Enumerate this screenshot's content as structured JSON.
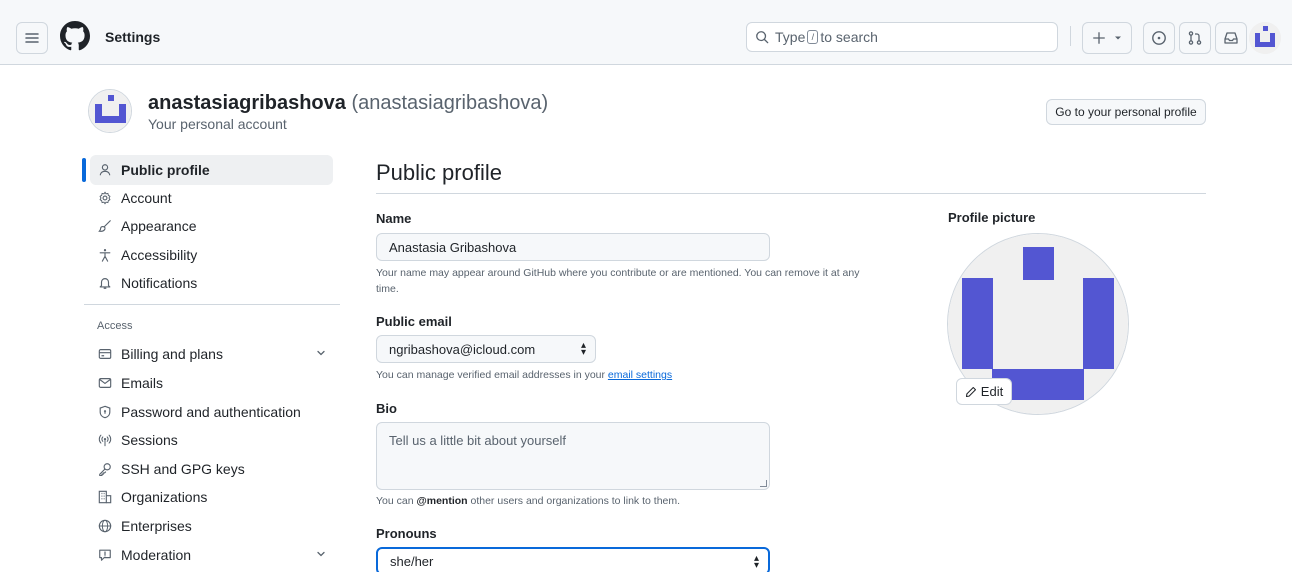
{
  "header": {
    "context_title": "Settings",
    "search": {
      "prefix": "Type",
      "key": "/",
      "suffix": "to search"
    }
  },
  "account": {
    "display_name": "anastasiagribashova",
    "login_paren": "(anastasiagribashova)",
    "subtitle": "Your personal account",
    "goto_label": "Go to your personal profile"
  },
  "sidebar": {
    "items": [
      {
        "label": "Public profile",
        "icon": "person-icon",
        "active": true
      },
      {
        "label": "Account",
        "icon": "gear-icon"
      },
      {
        "label": "Appearance",
        "icon": "paintbrush-icon"
      },
      {
        "label": "Accessibility",
        "icon": "accessibility-icon"
      },
      {
        "label": "Notifications",
        "icon": "bell-icon"
      }
    ],
    "access_heading": "Access",
    "access_items": [
      {
        "label": "Billing and plans",
        "icon": "credit-card-icon",
        "expandable": true
      },
      {
        "label": "Emails",
        "icon": "mail-icon"
      },
      {
        "label": "Password and authentication",
        "icon": "shield-lock-icon"
      },
      {
        "label": "Sessions",
        "icon": "broadcast-icon"
      },
      {
        "label": "SSH and GPG keys",
        "icon": "key-icon"
      },
      {
        "label": "Organizations",
        "icon": "organization-icon"
      },
      {
        "label": "Enterprises",
        "icon": "globe-icon"
      },
      {
        "label": "Moderation",
        "icon": "report-icon",
        "expandable": true
      }
    ]
  },
  "main": {
    "title": "Public profile",
    "name": {
      "label": "Name",
      "value": "Anastasia Gribashova",
      "note_line1": "Your name may appear around GitHub where you contribute or are mentioned. You can remove it at any",
      "note_line2": "time."
    },
    "email": {
      "label": "Public email",
      "value": "ngribashova@icloud.com",
      "note_prefix": "You can manage verified email addresses in your",
      "note_link": "email settings"
    },
    "bio": {
      "label": "Bio",
      "placeholder": "Tell us a little bit about yourself",
      "note_prefix": "You can",
      "note_bold": "@mention",
      "note_suffix": "other users and organizations to link to them."
    },
    "pronouns": {
      "label": "Pronouns",
      "value": "she/her"
    }
  },
  "profile_picture": {
    "label": "Profile picture",
    "edit_label": "Edit"
  },
  "colors": {
    "accent": "#0969da",
    "identicon": "#5356d2",
    "border": "#d0d7de",
    "muted": "#59636e"
  }
}
